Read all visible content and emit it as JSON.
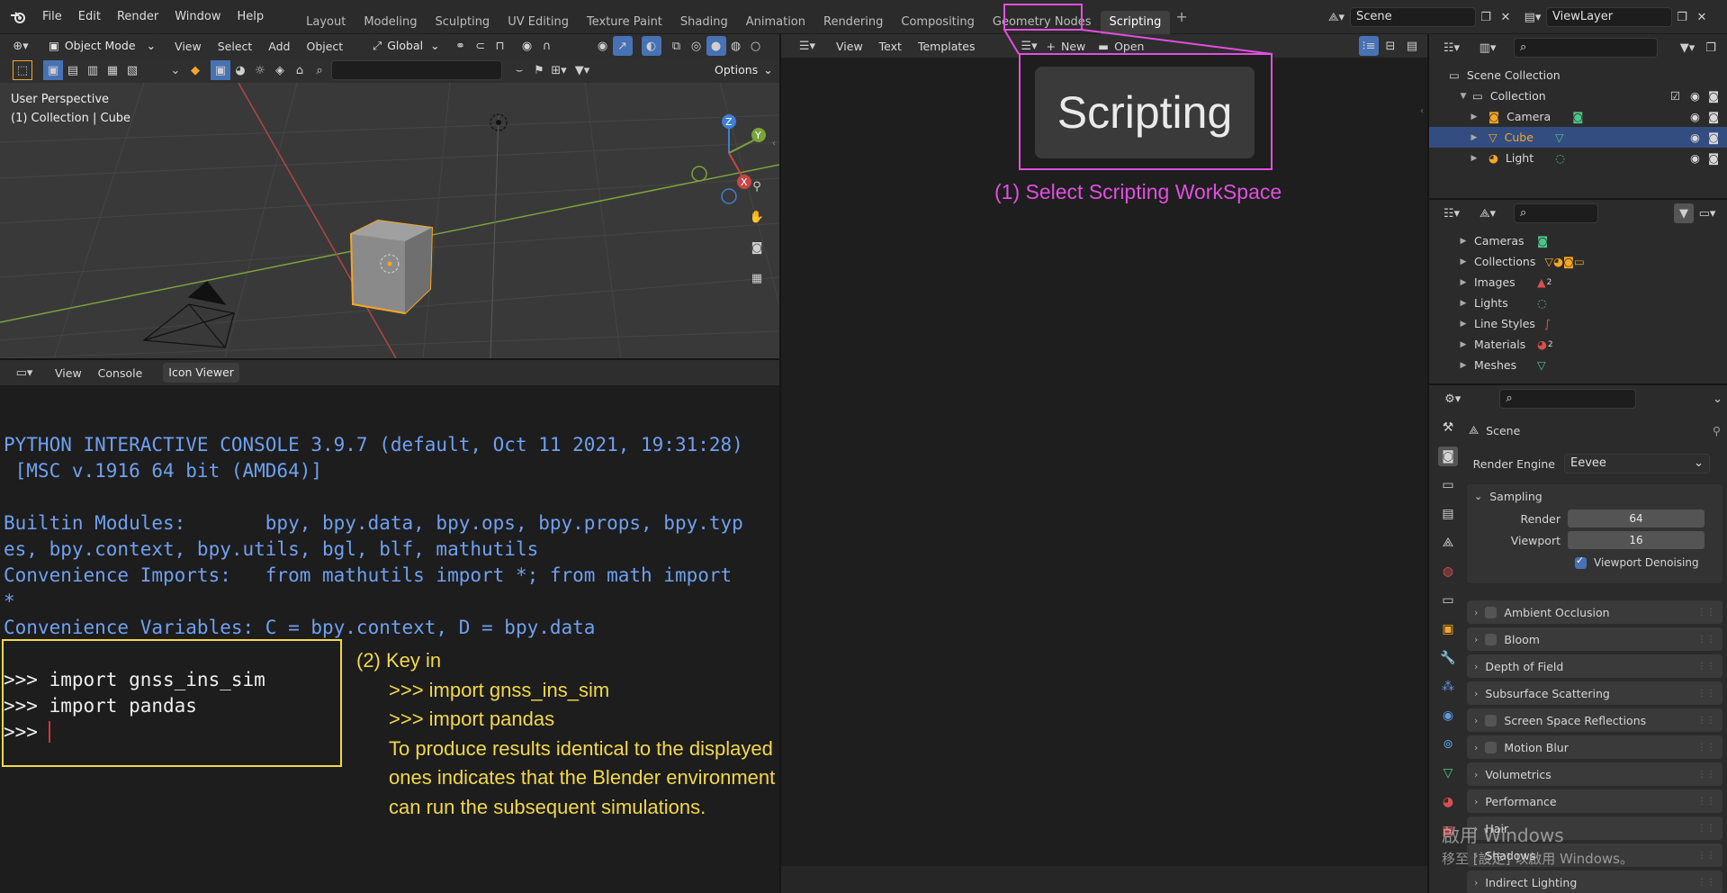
{
  "topbar": {
    "menu": [
      "File",
      "Edit",
      "Render",
      "Window",
      "Help"
    ],
    "workspaces": [
      "Layout",
      "Modeling",
      "Sculpting",
      "UV Editing",
      "Texture Paint",
      "Shading",
      "Animation",
      "Rendering",
      "Compositing",
      "Geometry Nodes",
      "Scripting"
    ],
    "active_workspace": "Scripting",
    "add_tab": "+",
    "scene_name": "Scene",
    "view_layer": "ViewLayer"
  },
  "viewport": {
    "mode": "Object Mode",
    "menu": [
      "View",
      "Select",
      "Add",
      "Object"
    ],
    "orientation": "Global",
    "options_label": "Options",
    "info_line1": "User Perspective",
    "info_line2": "(1) Collection | Cube",
    "gizmo": {
      "z": "Z",
      "y": "Y",
      "x": "X"
    }
  },
  "console": {
    "header_menu": [
      "View",
      "Console"
    ],
    "tab": "Icon Viewer",
    "lines": [
      {
        "text": "PYTHON INTERACTIVE CONSOLE 3.9.7 (default, Oct 11 2021, 19:31:28)",
        "color": "blue"
      },
      {
        "text": " [MSC v.1916 64 bit (AMD64)]",
        "color": "blue"
      },
      {
        "text": "",
        "color": "blue"
      },
      {
        "text": "Builtin Modules:       bpy, bpy.data, bpy.ops, bpy.props, bpy.typ",
        "color": "blue"
      },
      {
        "text": "es, bpy.context, bpy.utils, bgl, blf, mathutils",
        "color": "blue"
      },
      {
        "text": "Convenience Imports:   from mathutils import *; from math import",
        "color": "blue"
      },
      {
        "text": "*",
        "color": "blue"
      },
      {
        "text": "Convenience Variables: C = bpy.context, D = bpy.data",
        "color": "blue"
      },
      {
        "text": "",
        "color": "blue"
      },
      {
        "text": ">>> import gnss_ins_sim",
        "color": "white"
      },
      {
        "text": ">>> import pandas",
        "color": "white"
      },
      {
        "text": ">>> ",
        "color": "white"
      }
    ],
    "annotation": {
      "title": "(2) Key in",
      "lines": [
        ">>> import gnss_ins_sim",
        ">>> import pandas",
        "To produce results identical to the displayed",
        "ones indicates that the Blender environment",
        "can run the subsequent simulations."
      ]
    }
  },
  "text_editor": {
    "menu": [
      "View",
      "Text",
      "Templates"
    ],
    "new_label": "New",
    "open_label": "Open",
    "zoom_label": "Scripting",
    "annotation": "(1) Select Scripting WorkSpace"
  },
  "outliner": {
    "root": "Scene Collection",
    "collection": "Collection",
    "items": [
      "Camera",
      "Cube",
      "Light"
    ],
    "selected": "Cube"
  },
  "datablocks": {
    "items": [
      "Cameras",
      "Collections",
      "Images",
      "Lights",
      "Line Styles",
      "Materials",
      "Meshes"
    ],
    "badges": {
      "Images": "2",
      "Materials": "2"
    }
  },
  "properties": {
    "title": "Scene",
    "render_engine_label": "Render Engine",
    "render_engine": "Eevee",
    "sampling": "Sampling",
    "render_label": "Render",
    "render_value": "64",
    "viewport_label": "Viewport",
    "viewport_value": "16",
    "denoise_label": "Viewport Denoising",
    "panels": [
      {
        "label": "Ambient Occlusion",
        "checkbox": true
      },
      {
        "label": "Bloom",
        "checkbox": true
      },
      {
        "label": "Depth of Field",
        "checkbox": false
      },
      {
        "label": "Subsurface Scattering",
        "checkbox": false
      },
      {
        "label": "Screen Space Reflections",
        "checkbox": true
      },
      {
        "label": "Motion Blur",
        "checkbox": true
      },
      {
        "label": "Volumetrics",
        "checkbox": false
      },
      {
        "label": "Performance",
        "checkbox": false
      },
      {
        "label": "Hair",
        "checkbox": false
      },
      {
        "label": "Shadows",
        "checkbox": false
      },
      {
        "label": "Indirect Lighting",
        "checkbox": false
      }
    ]
  },
  "watermark": {
    "line1": "啟用 Windows",
    "line2": "移至 [設定] 以啟用 Windows。"
  },
  "colors": {
    "accent_magenta": "#e14fe0",
    "annotation_yellow": "#f2d84a",
    "console_blue": "#6fa0f0",
    "selection": "#334d80",
    "cube_orange": "#f5a623"
  }
}
